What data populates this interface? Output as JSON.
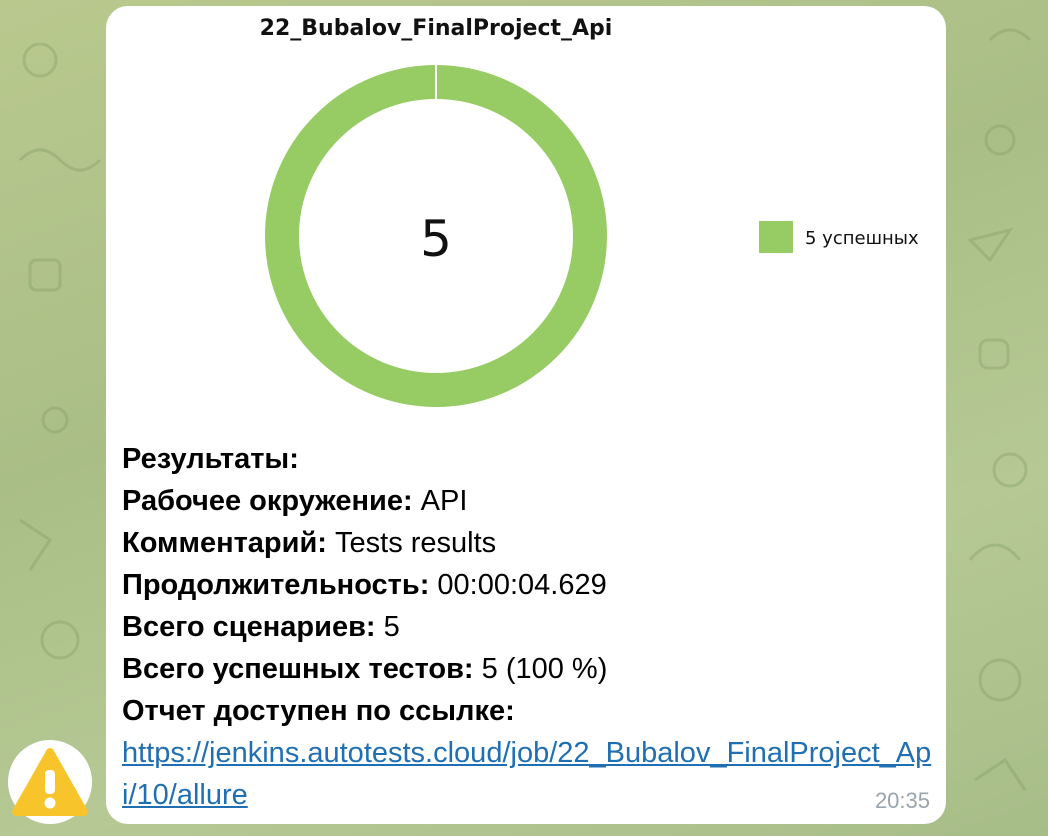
{
  "chart": {
    "title": "22_Bubalov_FinalProject_Api",
    "center_value": "5",
    "legend_label": "5 успешных",
    "colors": {
      "passed": "#97cc64"
    }
  },
  "chart_data": {
    "type": "pie",
    "title": "22_Bubalov_FinalProject_Api",
    "categories": [
      "5 успешных"
    ],
    "values": [
      5
    ],
    "center_label": "5",
    "legend_placement": "right"
  },
  "results": {
    "heading": "Результаты:",
    "env_label": "Рабочее окружение:",
    "env_value": " API",
    "comment_label": "Комментарий:",
    "comment_value": " Tests results",
    "duration_label": "Продолжительность:",
    "duration_value": " 00:00:04.629",
    "scenarios_label": "Всего сценариев:",
    "scenarios_value": " 5",
    "passed_label": "Всего успешных тестов:",
    "passed_value": " 5 (100 %)",
    "report_label": "Отчет доступен по ссылке:",
    "report_link": "https://jenkins.autotests.cloud/job/22_Bubalov_FinalProject_Api/10/allure"
  },
  "message": {
    "time": "20:35"
  },
  "avatar": {
    "icon": "warning-icon"
  }
}
